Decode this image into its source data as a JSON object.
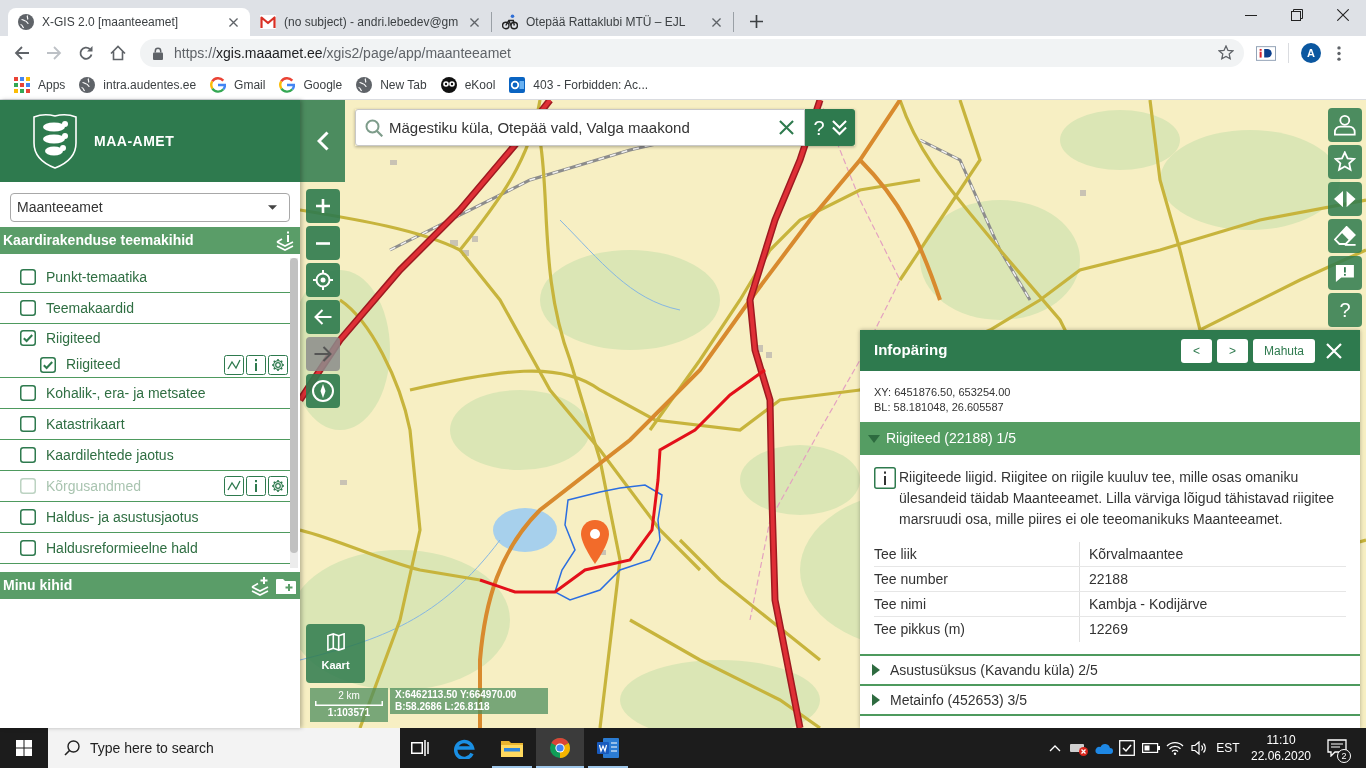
{
  "browser": {
    "tabs": [
      {
        "title": "X-GIS 2.0 [maanteeamet]",
        "selected": true
      },
      {
        "title": "(no subject) - andri.lebedev@gm",
        "selected": false
      },
      {
        "title": "Otepää Rattaklubi MTÜ – EJL",
        "selected": false
      }
    ],
    "address": {
      "scheme": "https://",
      "host": "xgis.maaamet.ee",
      "path": "/xgis2/page/app/maanteeamet"
    },
    "profile_initial": "A",
    "bookmarks": [
      "Apps",
      "intra.audentes.ee",
      "Gmail",
      "Google",
      "New Tab",
      "eKool",
      "403 - Forbidden: Ac..."
    ]
  },
  "sidebar": {
    "logo_text": "MAA-AMET",
    "profile_select": "Maanteeamet",
    "layers_title": "Kaardirakenduse teemakihid",
    "layers": [
      {
        "label": "Punkt-temaatika",
        "checked": false,
        "disabled": false,
        "tools": false
      },
      {
        "label": "Teemakaardid",
        "checked": false,
        "disabled": false,
        "tools": false
      },
      {
        "label": "Riigiteed",
        "checked": true,
        "disabled": false,
        "tools": false,
        "children": [
          {
            "label": "Riigiteed",
            "checked": true,
            "disabled": false,
            "tools": true
          }
        ]
      },
      {
        "label": "Kohalik-, era- ja metsatee",
        "checked": false,
        "disabled": false,
        "tools": false
      },
      {
        "label": "Katastrikaart",
        "checked": false,
        "disabled": false,
        "tools": false
      },
      {
        "label": "Kaardilehtede jaotus",
        "checked": false,
        "disabled": false,
        "tools": false
      },
      {
        "label": "Kõrgusandmed",
        "checked": false,
        "disabled": true,
        "tools": true
      },
      {
        "label": "Haldus- ja asustusjaotus",
        "checked": false,
        "disabled": false,
        "tools": false
      },
      {
        "label": "Haldusreformieelne hald",
        "checked": false,
        "disabled": false,
        "tools": false
      }
    ],
    "my_layers_title": "Minu kihid"
  },
  "map": {
    "search": {
      "value": "Mägestiku küla, Otepää vald, Valga maakond",
      "help": "?"
    },
    "controls": [
      {
        "disabled": false
      },
      {
        "disabled": false
      },
      {
        "disabled": false
      },
      {
        "disabled": false
      },
      {
        "disabled": true
      },
      {
        "disabled": false
      }
    ],
    "toolbar_help": "?",
    "basemap_button": "Kaart",
    "scale": {
      "distance": "2 km",
      "ratio": "1:103571"
    },
    "cursor_coordinates": [
      "X:6462113.50 Y:664970.00",
      "B:58.2686 L:26.8118"
    ]
  },
  "info_panel": {
    "title": "Infopäring",
    "previous": "<",
    "next": ">",
    "fit": "Mahuta",
    "coordinates": [
      "XY: 6451876.50, 653254.00",
      "BL: 58.181048, 26.605587"
    ],
    "sections": [
      {
        "title": "Riigiteed (22188) 1/5",
        "expanded": true,
        "description": "Riigiteede liigid. Riigitee on riigile kuuluv tee, mille osas omaniku ülesandeid täidab Maanteeamet. Lilla värviga lõigud tähistavad riigitee marsruudi osa, mille piires ei ole teeomanikuks Maanteeamet.",
        "rows": [
          {
            "label": "Tee liik",
            "value": "Kõrvalmaantee"
          },
          {
            "label": "Tee number",
            "value": "22188"
          },
          {
            "label": "Tee nimi",
            "value": "Kambja - Kodijärve"
          },
          {
            "label": "Tee pikkus (m)",
            "value": "12269"
          }
        ]
      },
      {
        "title": "Asustusüksus (Kavandu küla) 2/5",
        "expanded": false
      },
      {
        "title": "Metainfo (452653) 3/5",
        "expanded": false
      }
    ]
  },
  "taskbar": {
    "search_placeholder": "Type here to search",
    "apps": [
      {
        "selected": false,
        "running": false
      },
      {
        "selected": false,
        "running": true
      },
      {
        "selected": true,
        "running": true
      },
      {
        "selected": false,
        "running": true
      }
    ],
    "language": "EST",
    "time": "11:10",
    "date": "22.06.2020",
    "notification_count": "2"
  }
}
